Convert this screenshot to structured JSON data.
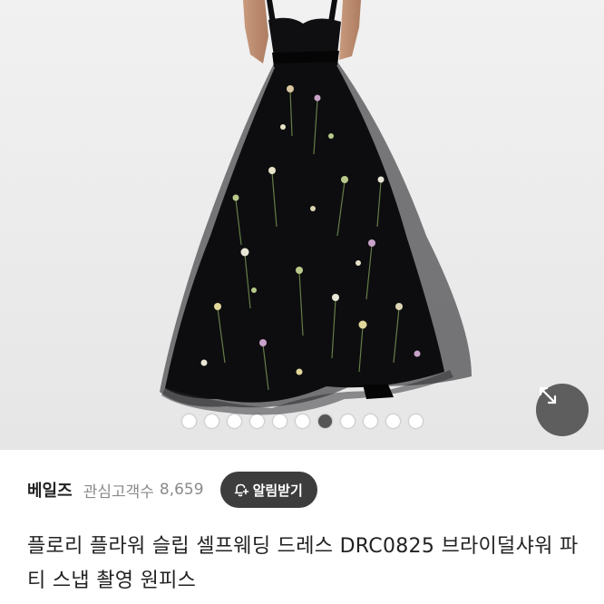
{
  "product_image": {
    "alt_icon": "dress-photo",
    "page_indicator": {
      "total": 11,
      "active_index": 6
    }
  },
  "expand_icon": "expand-arrows-icon",
  "store": {
    "name": "베일즈",
    "favorite_label": "관심고객수",
    "favorite_count": "8,659",
    "notify_icon": "bell-plus-icon",
    "notify_label": "알림받기"
  },
  "product": {
    "title": "플로리 플라워 슬립 셀프웨딩 드레스 DRC0825 브라이덜샤워 파티 스냅 촬영 원피스"
  },
  "colors": {
    "hero_background": "#eeeeee",
    "dress": "#0d0d0f",
    "notify_button": "#3d3d3d"
  }
}
